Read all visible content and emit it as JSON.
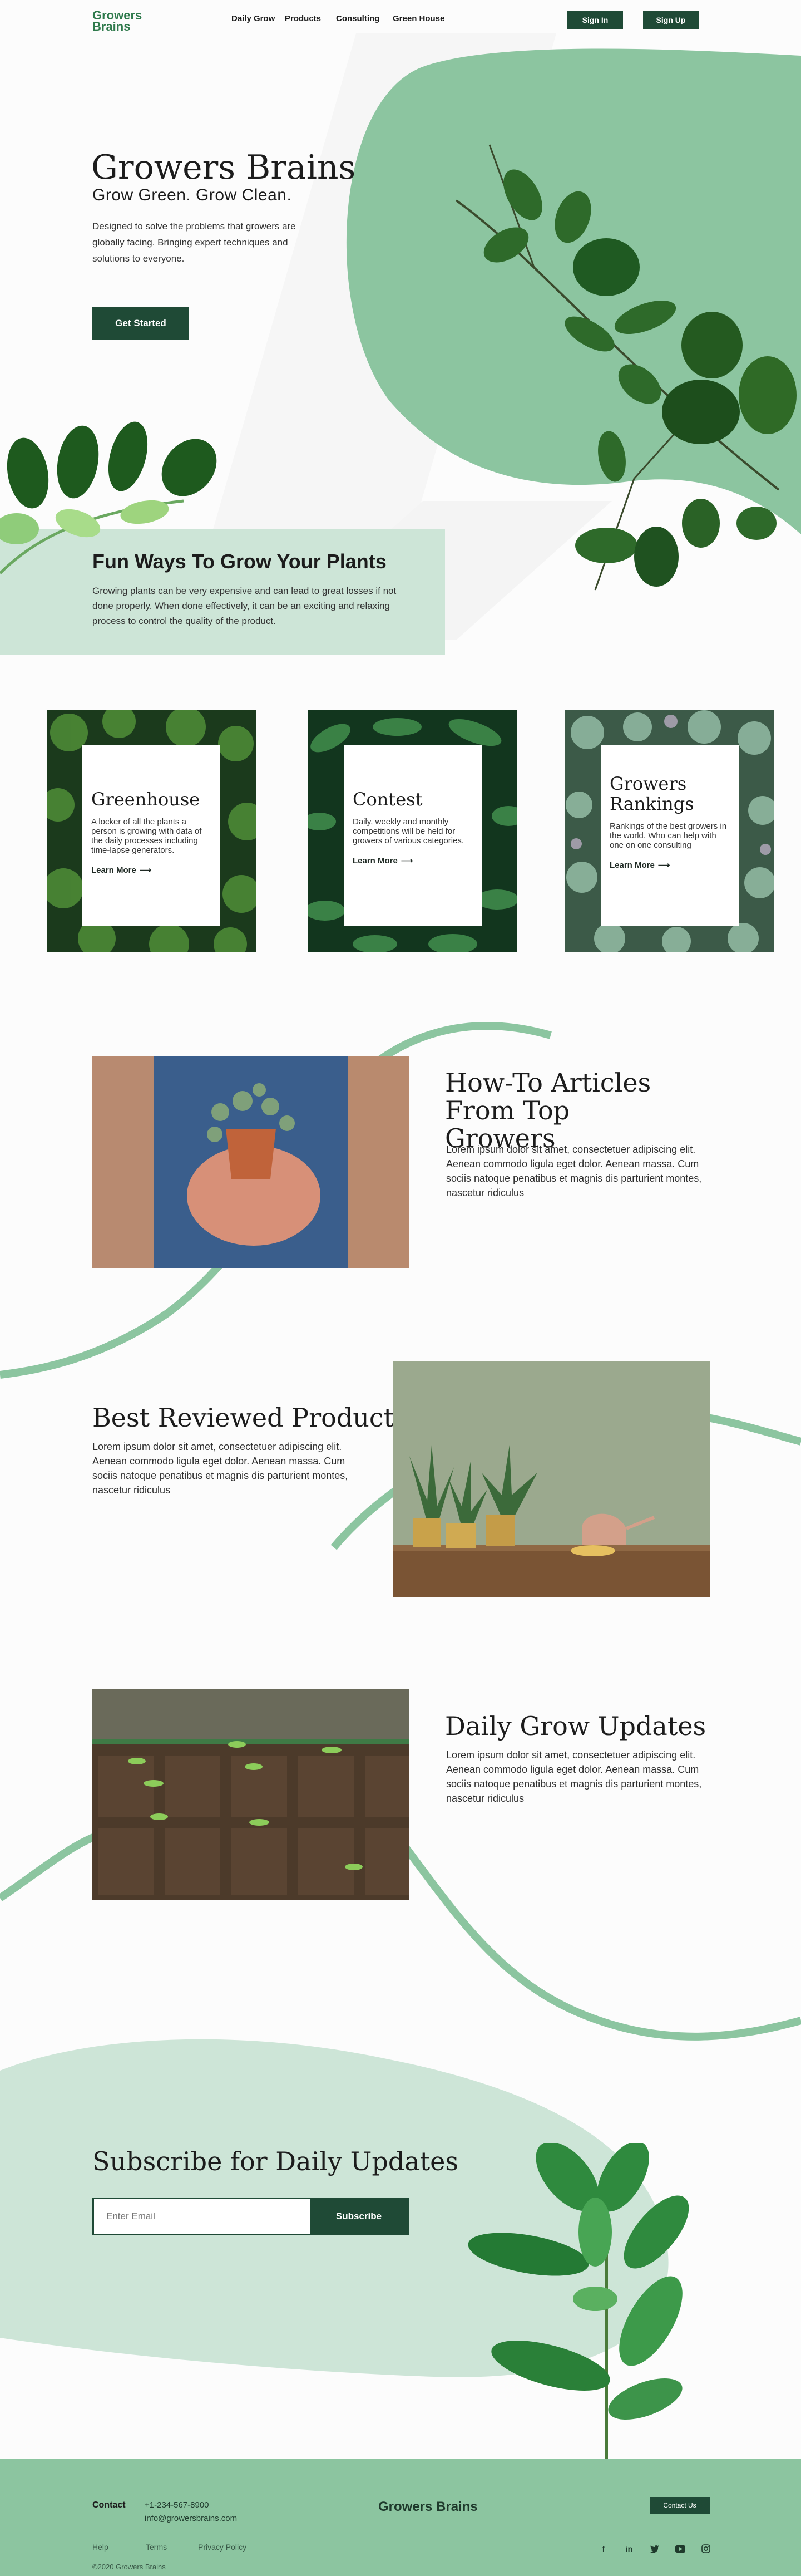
{
  "header": {
    "logo_line1": "Growers",
    "logo_line2": "Brains",
    "nav": [
      "Daily Grow",
      "Products",
      "Consulting",
      "Green House"
    ],
    "sign_in": "Sign In",
    "sign_up": "Sign Up"
  },
  "hero": {
    "title": "Growers Brains",
    "subtitle": "Grow Green. Grow Clean.",
    "description": "Designed to solve the problems that growers are globally facing. Bringing expert techniques and solutions to everyone.",
    "cta": "Get Started"
  },
  "fun_ways": {
    "title": "Fun Ways To Grow Your Plants",
    "text": "Growing plants can be very expensive and can lead to great losses if not done properly. When done effectively, it can be an exciting and relaxing process to control the quality of the product."
  },
  "cards": [
    {
      "title": "Greenhouse",
      "text": "A locker of all the plants a person is growing with data of the daily processes including time-lapse generators.",
      "link": "Learn More"
    },
    {
      "title": "Contest",
      "text": "Daily, weekly and monthly competitions will be held for growers of various categories.",
      "link": "Learn More"
    },
    {
      "title": "Growers Rankings",
      "text": "Rankings of the best growers in the world. Who can help with one on one consulting",
      "link": "Learn More"
    }
  ],
  "articles": {
    "title": "How-To Articles From Top Growers",
    "text": "Lorem ipsum dolor sit amet, consectetuer adipiscing elit. Aenean commodo ligula eget dolor. Aenean massa. Cum sociis natoque penatibus et magnis dis parturient montes, nascetur ridiculus"
  },
  "products": {
    "title": "Best Reviewed Products",
    "text": "Lorem ipsum dolor sit amet, consectetuer adipiscing elit. Aenean commodo ligula eget dolor. Aenean massa. Cum sociis natoque penatibus et magnis dis parturient montes, nascetur ridiculus"
  },
  "updates": {
    "title": "Daily Grow Updates",
    "text": "Lorem ipsum dolor sit amet, consectetuer adipiscing elit. Aenean commodo ligula eget dolor. Aenean massa. Cum sociis natoque penatibus et magnis dis parturient montes, nascetur ridiculus"
  },
  "subscribe": {
    "title": "Subscribe for Daily Updates",
    "placeholder": "Enter Email",
    "button": "Subscribe"
  },
  "footer": {
    "contact_label": "Contact",
    "phone": "+1-234-567-8900",
    "email": "info@growersbrains.com",
    "brand": "Growers Brains",
    "contact_button": "Contact Us",
    "links": [
      "Help",
      "Terms",
      "Privacy Policy"
    ],
    "social_icons": [
      "facebook-icon",
      "linkedin-icon",
      "twitter-icon",
      "youtube-icon",
      "instagram-icon"
    ],
    "copyright": "©2020 Growers Brains"
  },
  "colors": {
    "accent_green": "#8cc5a0",
    "light_green": "#cde5d7",
    "dark_green": "#1f4a36"
  }
}
